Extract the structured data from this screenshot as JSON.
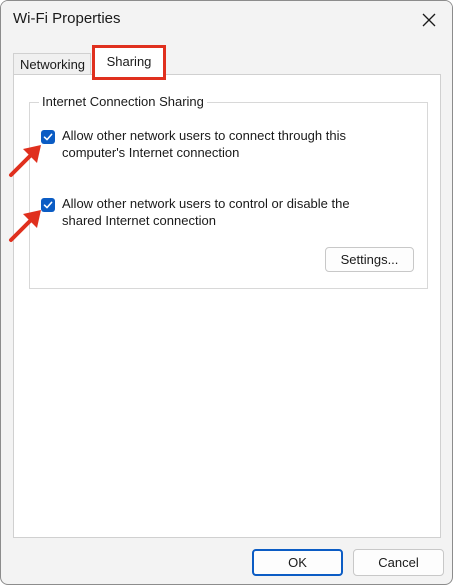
{
  "window": {
    "title": "Wi-Fi Properties"
  },
  "tabs": [
    {
      "label": "Networking",
      "selected": false
    },
    {
      "label": "Sharing",
      "selected": true
    }
  ],
  "group": {
    "legend": "Internet Connection Sharing",
    "options": [
      {
        "line1": "Allow other network users to connect through this",
        "line2": "computer's Internet connection",
        "checked": true
      },
      {
        "line1": "Allow other network users to control or disable the",
        "line2": "shared Internet connection",
        "checked": true
      }
    ],
    "settings_label": "Settings..."
  },
  "footer": {
    "ok_label": "OK",
    "cancel_label": "Cancel"
  },
  "colors": {
    "accent": "#0b5cc4",
    "annotation": "#e0301e"
  },
  "icons": [
    "close-icon",
    "checkmark-icon",
    "arrow-icon"
  ]
}
